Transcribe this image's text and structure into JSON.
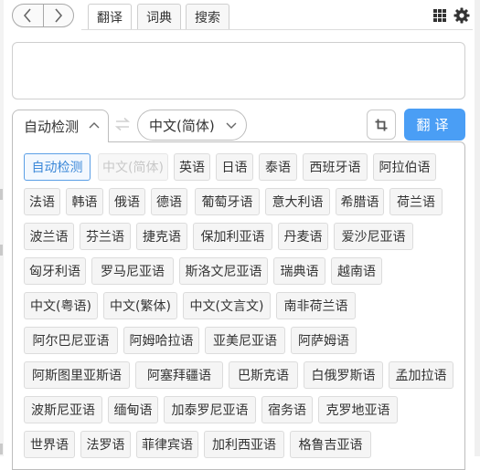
{
  "tabs": [
    "翻译",
    "词典",
    "搜索"
  ],
  "input": {
    "value": "",
    "placeholder": ""
  },
  "source_lang": "自动检测",
  "target_lang": "中文(简体)",
  "translate_label": "翻译",
  "languages": [
    [
      "自动检测",
      "中文(简体)",
      "英语",
      "日语",
      "泰语",
      "西班牙语",
      "阿拉伯语"
    ],
    [
      "法语",
      "韩语",
      "俄语",
      "德语",
      "葡萄牙语",
      "意大利语",
      "希腊语",
      "荷兰语"
    ],
    [
      "波兰语",
      "芬兰语",
      "捷克语",
      "保加利亚语",
      "丹麦语",
      "爱沙尼亚语"
    ],
    [
      "匈牙利语",
      "罗马尼亚语",
      "斯洛文尼亚语",
      "瑞典语",
      "越南语"
    ],
    [
      "中文(粤语)",
      "中文(繁体)",
      "中文(文言文)",
      "南非荷兰语"
    ],
    [
      "阿尔巴尼亚语",
      "阿姆哈拉语",
      "亚美尼亚语",
      "阿萨姆语"
    ],
    [
      "阿斯图里亚斯语",
      "阿塞拜疆语",
      "巴斯克语",
      "白俄罗斯语",
      "孟加拉语"
    ],
    [
      "波斯尼亚语",
      "缅甸语",
      "加泰罗尼亚语",
      "宿务语",
      "克罗地亚语"
    ],
    [
      "世界语",
      "法罗语",
      "菲律宾语",
      "加利西亚语",
      "格鲁吉亚语"
    ]
  ],
  "selected_language": "自动检测",
  "disabled_language": "中文(简体)",
  "colors": {
    "accent": "#4a9ef5",
    "selected_text": "#3a87d8"
  }
}
